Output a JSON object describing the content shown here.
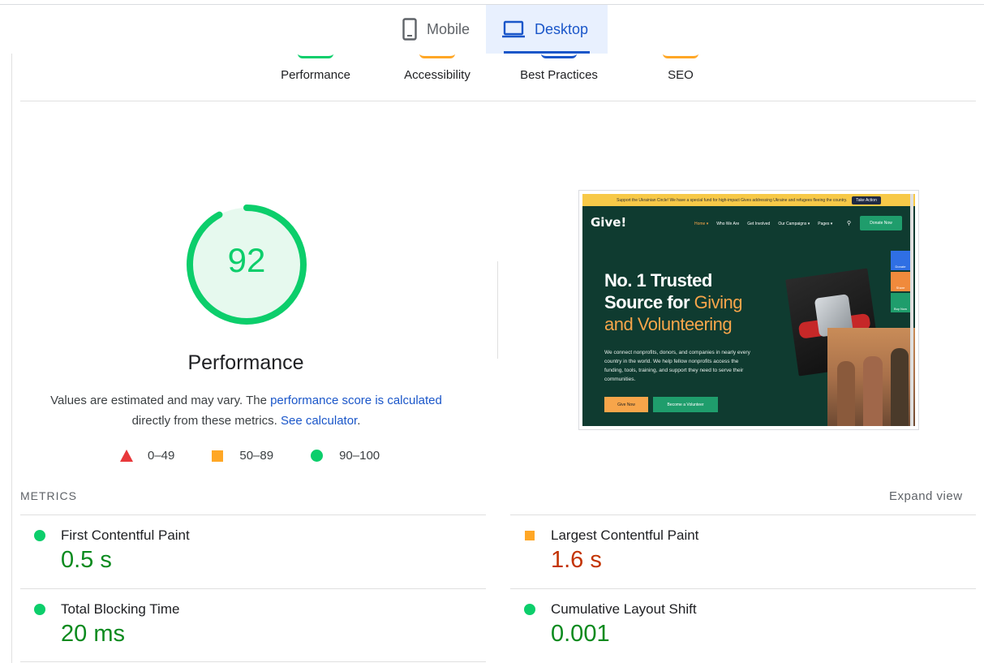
{
  "device_tabs": [
    {
      "label": "Mobile",
      "icon": "phone-icon",
      "active": false
    },
    {
      "label": "Desktop",
      "icon": "laptop-icon",
      "active": true
    }
  ],
  "categories": [
    {
      "label": "Performance",
      "color": "#0cce6b"
    },
    {
      "label": "Accessibility",
      "color": "#ffa726"
    },
    {
      "label": "Best Practices",
      "color": "#1a56c9"
    },
    {
      "label": "SEO",
      "color": "#ffa726"
    }
  ],
  "performance": {
    "score": "92",
    "score_fraction": 0.92,
    "title": "Performance",
    "desc_prefix": "Values are estimated and may vary. The ",
    "desc_link1": "performance score is calculated",
    "desc_middle": " directly from these metrics. ",
    "desc_link2": "See calculator",
    "desc_suffix": "."
  },
  "legend": [
    {
      "label": "0–49",
      "shape": "triangle",
      "color": "#e8383b"
    },
    {
      "label": "50–89",
      "shape": "square",
      "color": "#ffa726"
    },
    {
      "label": "90–100",
      "shape": "circle",
      "color": "#0cce6b"
    }
  ],
  "preview": {
    "banner": "Support the Ukrainian Circle! We have a special fund for high-impact Gives addressing Ukraine and refugees fleeing the country.",
    "banner_button": "Take Action",
    "logo": "Give!",
    "menu": [
      "Home ▾",
      "Who We Are",
      "Get Involved",
      "Our Campaigns ▾",
      "Pages ▾"
    ],
    "donate": "Donate Now",
    "side_buttons": [
      "Donate",
      "Share",
      "Buy Now"
    ],
    "headline_1": "No. 1 Trusted",
    "headline_2a": "Source for ",
    "headline_2b": "Giving",
    "headline_3": "and Volunteering",
    "paragraph": "We connect nonprofits, donors, and companies in nearly every country in the world. We help fellow nonprofits access the funding, tools, training, and support they need to serve their communities.",
    "button_1": "Give Now",
    "button_2": "Become a Volunteer"
  },
  "metrics": {
    "header": "METRICS",
    "expand": "Expand view",
    "items": [
      {
        "name": "First Contentful Paint",
        "value": "0.5 s",
        "status": "good"
      },
      {
        "name": "Largest Contentful Paint",
        "value": "1.6 s",
        "status": "average"
      },
      {
        "name": "Total Blocking Time",
        "value": "20 ms",
        "status": "good"
      },
      {
        "name": "Cumulative Layout Shift",
        "value": "0.001",
        "status": "good"
      }
    ]
  }
}
